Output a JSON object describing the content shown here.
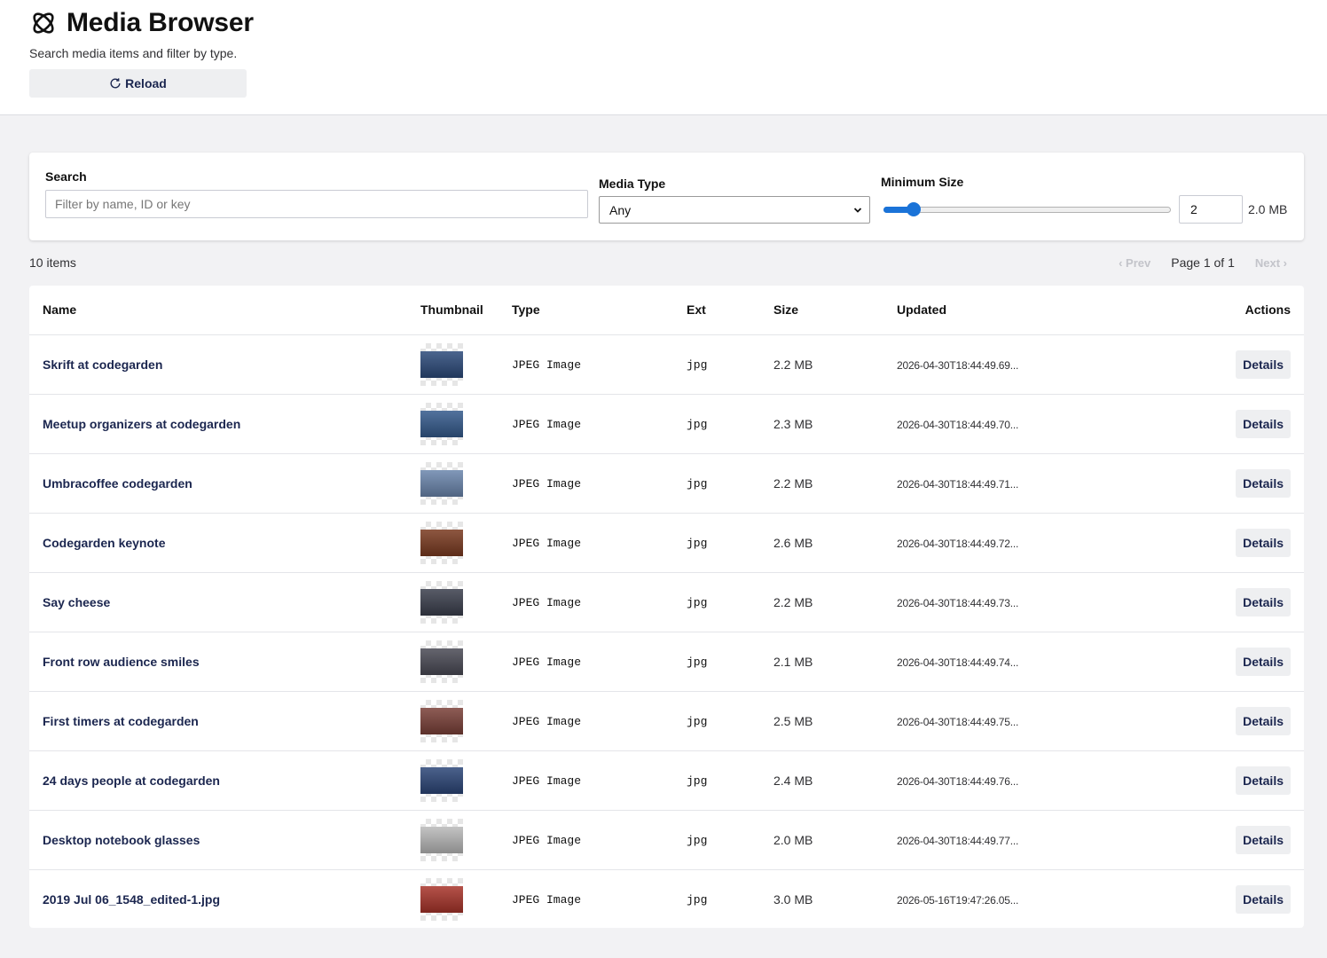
{
  "header": {
    "title": "Media Browser",
    "subtitle": "Search media items and filter by type.",
    "reload_label": "Reload"
  },
  "filters": {
    "search_label": "Search",
    "search_placeholder": "Filter by name, ID or key",
    "search_value": "",
    "type_label": "Media Type",
    "type_value": "Any",
    "size_label": "Minimum Size",
    "size_value": "2",
    "size_readout": "2.0 MB",
    "size_slider_fraction": 0.08
  },
  "summary": {
    "count": "10 items",
    "prev": "‹ Prev",
    "page_info": "Page 1 of 1",
    "next": "Next ›"
  },
  "table": {
    "columns": {
      "name": "Name",
      "thumbnail": "Thumbnail",
      "type": "Type",
      "ext": "Ext",
      "size": "Size",
      "updated": "Updated",
      "actions": "Actions"
    },
    "action_label": "Details",
    "rows": [
      {
        "name": "Skrift at codegarden",
        "type": "JPEG Image",
        "ext": "jpg",
        "size": "2.2 MB",
        "updated": "2026-04-30T18:44:49.69...",
        "thumb_color": "#2c4a7a"
      },
      {
        "name": "Meetup organizers at codegarden",
        "type": "JPEG Image",
        "ext": "jpg",
        "size": "2.3 MB",
        "updated": "2026-04-30T18:44:49.70...",
        "thumb_color": "#345a8c"
      },
      {
        "name": "Umbracoffee codegarden",
        "type": "JPEG Image",
        "ext": "jpg",
        "size": "2.2 MB",
        "updated": "2026-04-30T18:44:49.71...",
        "thumb_color": "#6b86ad"
      },
      {
        "name": "Codegarden keynote",
        "type": "JPEG Image",
        "ext": "jpg",
        "size": "2.6 MB",
        "updated": "2026-04-30T18:44:49.72...",
        "thumb_color": "#7a3a20"
      },
      {
        "name": "Say cheese",
        "type": "JPEG Image",
        "ext": "jpg",
        "size": "2.2 MB",
        "updated": "2026-04-30T18:44:49.73...",
        "thumb_color": "#3b3f4d"
      },
      {
        "name": "Front row audience smiles",
        "type": "JPEG Image",
        "ext": "jpg",
        "size": "2.1 MB",
        "updated": "2026-04-30T18:44:49.74...",
        "thumb_color": "#4a4a55"
      },
      {
        "name": "First timers at codegarden",
        "type": "JPEG Image",
        "ext": "jpg",
        "size": "2.5 MB",
        "updated": "2026-04-30T18:44:49.75...",
        "thumb_color": "#7a4038"
      },
      {
        "name": "24 days people at codegarden",
        "type": "JPEG Image",
        "ext": "jpg",
        "size": "2.4 MB",
        "updated": "2026-04-30T18:44:49.76...",
        "thumb_color": "#2c4678"
      },
      {
        "name": "Desktop notebook glasses",
        "type": "JPEG Image",
        "ext": "jpg",
        "size": "2.0 MB",
        "updated": "2026-04-30T18:44:49.77...",
        "thumb_color": "#b9b9b9"
      },
      {
        "name": "2019 Jul 06_1548_edited-1.jpg",
        "type": "JPEG Image",
        "ext": "jpg",
        "size": "3.0 MB",
        "updated": "2026-05-16T19:47:26.05...",
        "thumb_color": "#a8342a"
      }
    ]
  },
  "colors": {
    "accent": "#1a73d8",
    "text_dark": "#1b264f",
    "page_bg": "#f2f2f4"
  },
  "icons": {
    "logo": "umbraco-logo-icon",
    "reload": "refresh-icon",
    "select": "chevron-down-icon"
  }
}
